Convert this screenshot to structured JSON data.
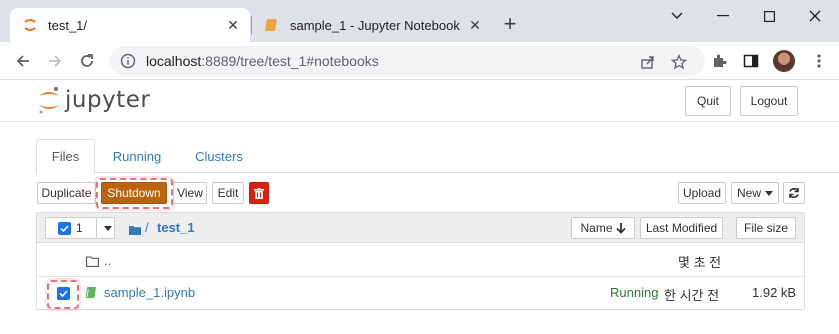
{
  "browser": {
    "tabs": [
      {
        "title": "test_1/",
        "active": true
      },
      {
        "title": "sample_1 - Jupyter Notebook",
        "active": false
      }
    ],
    "url_host": "localhost",
    "url_path": ":8889/tree/test_1#notebooks"
  },
  "header": {
    "logo_text": "jupyter",
    "quit_label": "Quit",
    "logout_label": "Logout"
  },
  "tabs": {
    "files": "Files",
    "running": "Running",
    "clusters": "Clusters"
  },
  "actions": {
    "duplicate": "Duplicate",
    "shutdown": "Shutdown",
    "view": "View",
    "edit": "Edit",
    "upload": "Upload",
    "new": "New"
  },
  "list": {
    "selected_count": "1",
    "breadcrumb_folder": "test_1",
    "sort_name": "Name",
    "sort_last_modified": "Last Modified",
    "sort_file_size": "File size",
    "rows": [
      {
        "name": "..",
        "status": "",
        "modified": "몇 초 전",
        "size": ""
      },
      {
        "name": "sample_1.ipynb",
        "status": "Running",
        "modified": "한 시간 전",
        "size": "1.92 kB"
      }
    ]
  },
  "colors": {
    "shutdown": "#b9640f",
    "trash": "#d9230f",
    "running": "#2e7d32",
    "link": "#337ab7",
    "highlight": "#e5737b"
  }
}
